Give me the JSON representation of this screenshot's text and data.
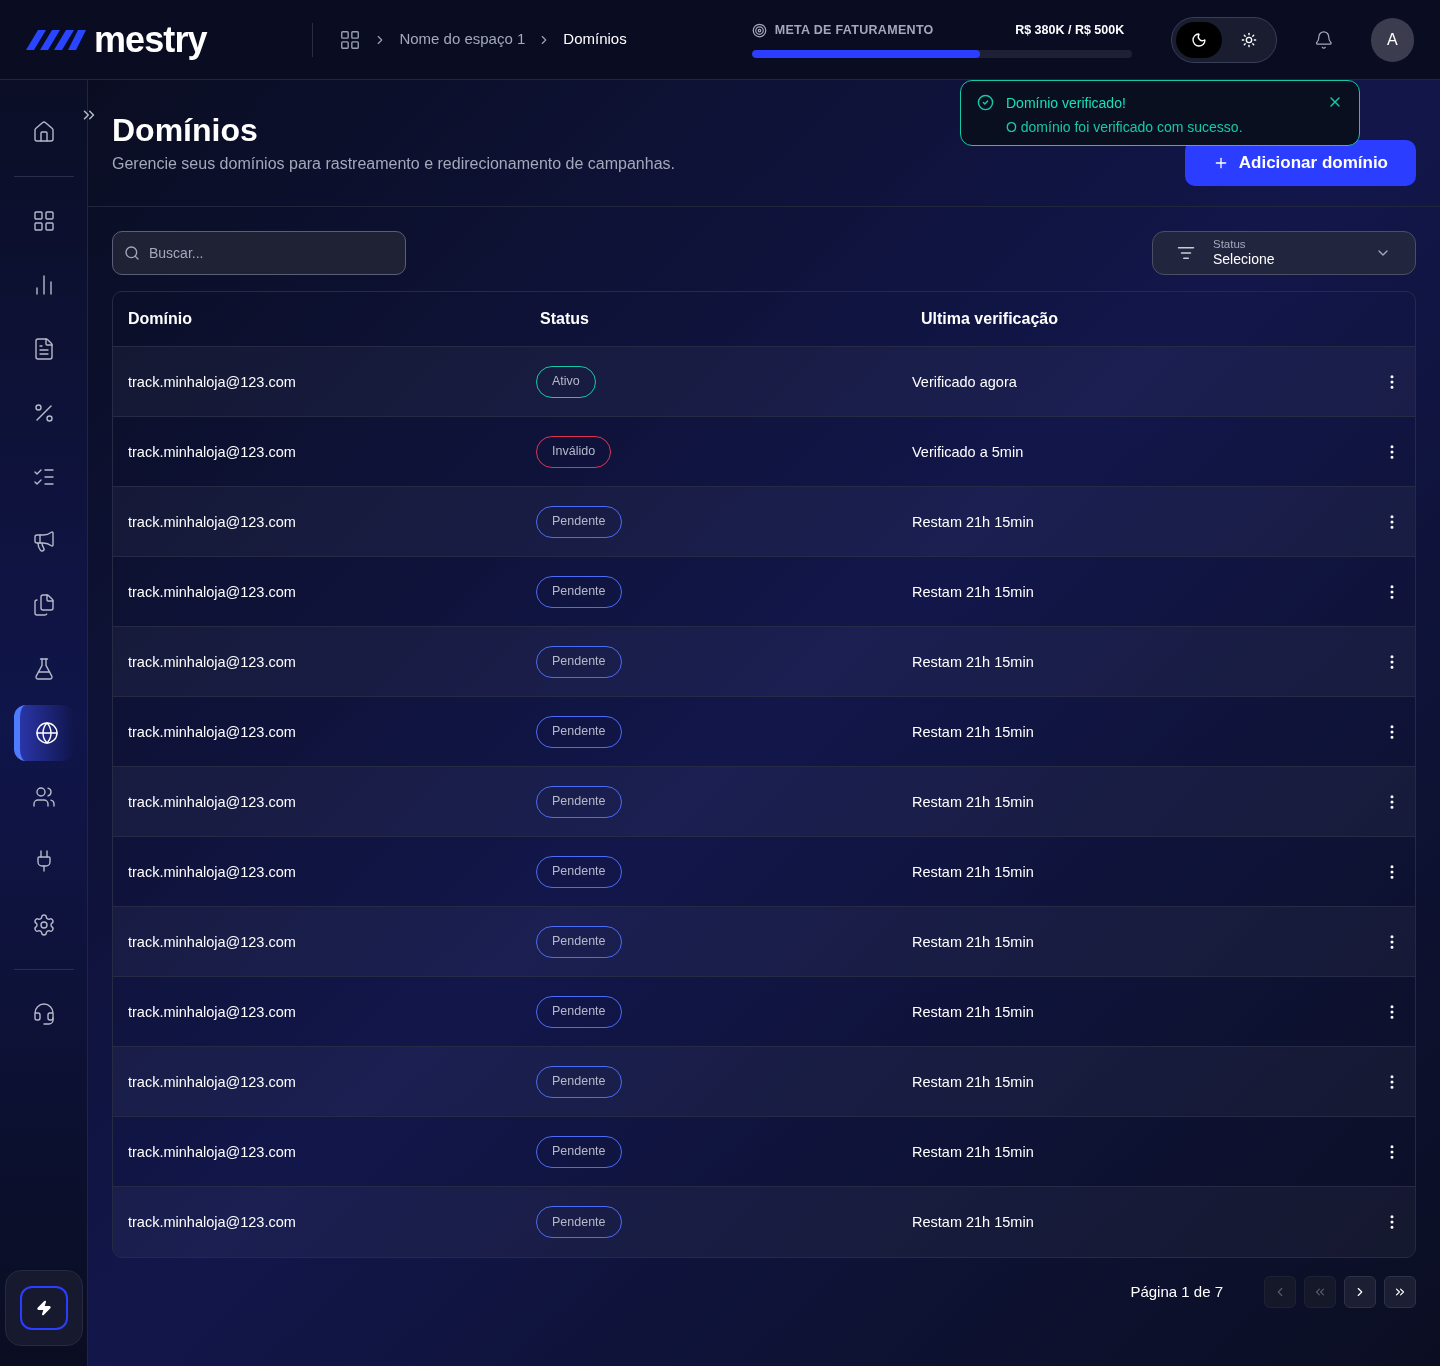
{
  "logo": {
    "text": "mestry"
  },
  "breadcrumb": [
    {
      "label": "Nome do espaço 1",
      "current": false
    },
    {
      "label": "Domínios",
      "current": true
    }
  ],
  "goal": {
    "label": "META DE FATURAMENTO",
    "reading": "R$ 380K / R$ 500K",
    "level": 0.6
  },
  "theme_toggle": [
    {
      "kind": "dark",
      "selected": true
    },
    {
      "kind": "light",
      "selected": false
    }
  ],
  "avatar": {
    "initial": "A"
  },
  "sidebar": {
    "items": [
      {
        "kind": "home",
        "selected": false
      },
      {
        "kind": "divider"
      },
      {
        "kind": "grid",
        "selected": false
      },
      {
        "kind": "chart",
        "selected": false
      },
      {
        "kind": "file",
        "selected": false
      },
      {
        "kind": "percent",
        "selected": false
      },
      {
        "kind": "checklist",
        "selected": false
      },
      {
        "kind": "megaphone",
        "selected": false
      },
      {
        "kind": "files",
        "selected": false
      },
      {
        "kind": "flask",
        "selected": false
      },
      {
        "kind": "globe",
        "selected": true
      },
      {
        "kind": "users",
        "selected": false
      },
      {
        "kind": "plug",
        "selected": false
      },
      {
        "kind": "settings",
        "selected": false
      },
      {
        "kind": "divider"
      },
      {
        "kind": "headset",
        "selected": false
      }
    ]
  },
  "page": {
    "title": "Domínios",
    "subtitle": "Gerencie seus domínios para rastreamento e redirecionamento de campanhas.",
    "add_button": "Adicionar domínio"
  },
  "toast": {
    "title": "Domínio verificado!",
    "message": "O domínio foi verificado com sucesso."
  },
  "search": {
    "placeholder": "Buscar..."
  },
  "status_filter": {
    "label": "Status",
    "value": "Selecione"
  },
  "table": {
    "columns": [
      "Domínio",
      "Status",
      "Ultima verificação"
    ],
    "rows": [
      {
        "domain": "track.minhaloja@123.com",
        "status": "Ativo",
        "kind": "active",
        "last_check": "Verificado agora"
      },
      {
        "domain": "track.minhaloja@123.com",
        "status": "Inválido",
        "kind": "invalid",
        "last_check": "Verificado a 5min"
      },
      {
        "domain": "track.minhaloja@123.com",
        "status": "Pendente",
        "kind": "pending",
        "last_check": "Restam 21h 15min"
      },
      {
        "domain": "track.minhaloja@123.com",
        "status": "Pendente",
        "kind": "pending",
        "last_check": "Restam 21h 15min"
      },
      {
        "domain": "track.minhaloja@123.com",
        "status": "Pendente",
        "kind": "pending",
        "last_check": "Restam 21h 15min"
      },
      {
        "domain": "track.minhaloja@123.com",
        "status": "Pendente",
        "kind": "pending",
        "last_check": "Restam 21h 15min"
      },
      {
        "domain": "track.minhaloja@123.com",
        "status": "Pendente",
        "kind": "pending",
        "last_check": "Restam 21h 15min"
      },
      {
        "domain": "track.minhaloja@123.com",
        "status": "Pendente",
        "kind": "pending",
        "last_check": "Restam 21h 15min"
      },
      {
        "domain": "track.minhaloja@123.com",
        "status": "Pendente",
        "kind": "pending",
        "last_check": "Restam 21h 15min"
      },
      {
        "domain": "track.minhaloja@123.com",
        "status": "Pendente",
        "kind": "pending",
        "last_check": "Restam 21h 15min"
      },
      {
        "domain": "track.minhaloja@123.com",
        "status": "Pendente",
        "kind": "pending",
        "last_check": "Restam 21h 15min"
      },
      {
        "domain": "track.minhaloja@123.com",
        "status": "Pendente",
        "kind": "pending",
        "last_check": "Restam 21h 15min"
      },
      {
        "domain": "track.minhaloja@123.com",
        "status": "Pendente",
        "kind": "pending",
        "last_check": "Restam 21h 15min"
      }
    ]
  },
  "pagination": {
    "label": "Página 1 de 7",
    "buttons": [
      {
        "kind": "prev",
        "disabled": true
      },
      {
        "kind": "first",
        "disabled": true
      },
      {
        "kind": "next",
        "disabled": false
      },
      {
        "kind": "last",
        "disabled": false
      }
    ]
  }
}
